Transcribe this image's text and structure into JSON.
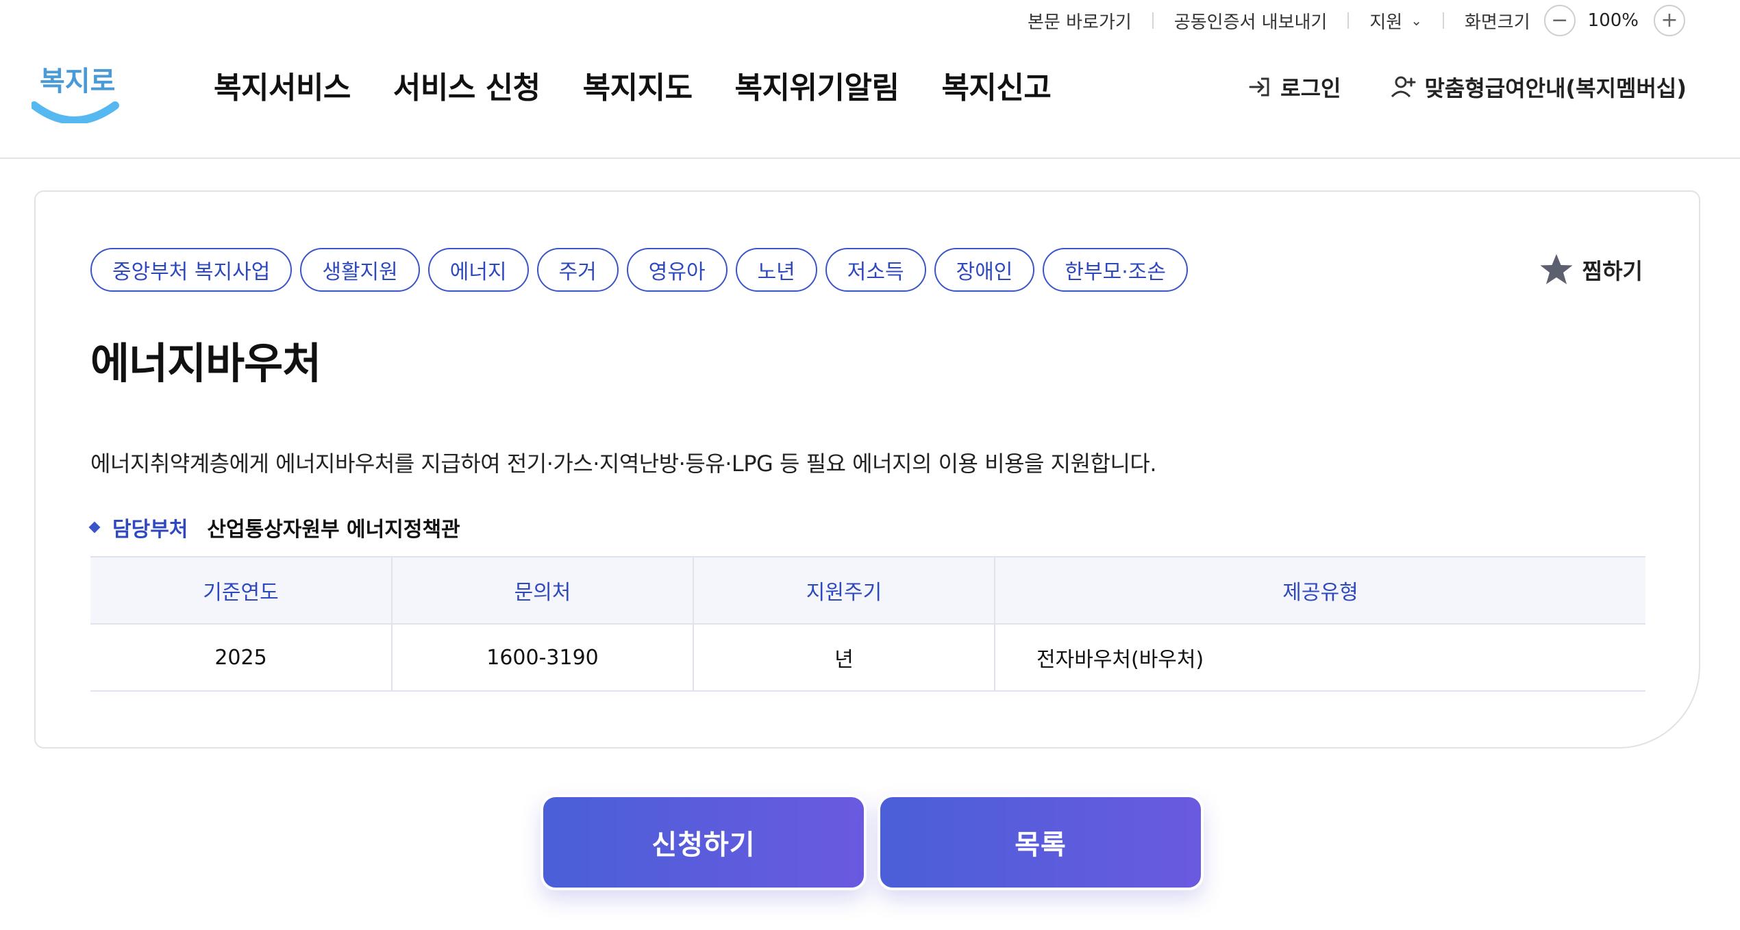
{
  "utility": {
    "skip_to_content": "본문 바로가기",
    "cert_export": "공동인증서 내보내기",
    "support": "지원",
    "screen_size": "화면크기",
    "zoom_level": "100%",
    "zoom_out": "−",
    "zoom_in": "+"
  },
  "header": {
    "logo_text": "복지로",
    "nav": [
      "복지서비스",
      "서비스 신청",
      "복지지도",
      "복지위기알림",
      "복지신고"
    ],
    "login": "로그인",
    "membership": "맞춤형급여안내(복지멤버십)"
  },
  "service": {
    "tags": [
      "중앙부처 복지사업",
      "생활지원",
      "에너지",
      "주거",
      "영유아",
      "노년",
      "저소득",
      "장애인",
      "한부모·조손"
    ],
    "bookmark_label": "찜하기",
    "title": "에너지바우처",
    "description": "에너지취약계층에게 에너지바우처를 지급하여 전기·가스·지역난방·등유·LPG 등 필요 에너지의 이용 비용을 지원합니다.",
    "dept_label": "담당부처",
    "dept_value": "산업통상자원부 에너지정책관",
    "table": {
      "headers": [
        "기준연도",
        "문의처",
        "지원주기",
        "제공유형"
      ],
      "row": [
        "2025",
        "1600-3190",
        "년",
        "전자바우처(바우처)"
      ]
    }
  },
  "actions": {
    "apply": "신청하기",
    "list": "목록"
  },
  "colors": {
    "accent": "#2e49c0",
    "button_start": "#4a5fd8",
    "button_end": "#6a5ae0",
    "logo_smile": "#55b8f0"
  }
}
